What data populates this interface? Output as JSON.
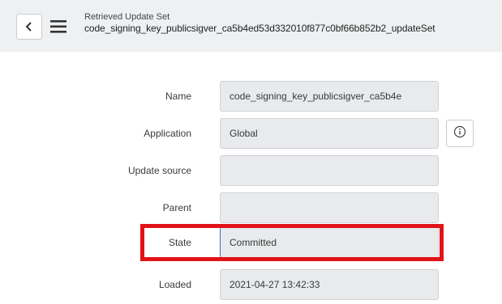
{
  "header": {
    "subtitle": "Retrieved Update Set",
    "title": "code_signing_key_publicsigver_ca5b4ed53d332010f877c0bf66b852b2_updateSet"
  },
  "icons": {
    "back": "chevron-left-icon",
    "menu": "hamburger-menu-icon",
    "info": "info-circle-icon"
  },
  "colors": {
    "header_bg": "#eef0f2",
    "field_bg": "#e8eaec",
    "highlight": "#e11318",
    "focus_accent": "#3b73b9"
  },
  "form": {
    "fields": [
      {
        "label": "Name",
        "value": "code_signing_key_publicsigver_ca5b4e"
      },
      {
        "label": "Application",
        "value": "Global"
      },
      {
        "label": "Update source",
        "value": ""
      },
      {
        "label": "Parent",
        "value": ""
      },
      {
        "label": "State",
        "value": "Committed"
      },
      {
        "label": "Loaded",
        "value": "2021-04-27 13:42:33"
      }
    ]
  }
}
